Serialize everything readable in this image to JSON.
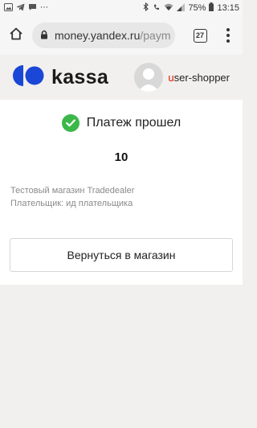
{
  "status_bar": {
    "battery": "75%",
    "time": "13:15",
    "notification_icons": [
      "image-icon",
      "telegram-icon",
      "chat-icon"
    ],
    "system_icons": [
      "bluetooth-icon",
      "wifi-icon",
      "signal-icon",
      "battery-icon"
    ]
  },
  "browser": {
    "url_host": "money.yandex.ru",
    "url_path": "/paym",
    "tab_count": "27"
  },
  "header": {
    "logo_text": "kassa",
    "user_first_letter": "u",
    "user_rest": "ser-shopper"
  },
  "payment": {
    "status": "Платеж прошел",
    "amount": "10",
    "shop": "Тестовый магазин Tradedealer",
    "payer": "Плательщик: ид плательщика",
    "return_button": "Вернуться в магазин"
  },
  "colors": {
    "accent_blue": "#1a47d6",
    "success_green": "#3cb84a",
    "brand_red": "#e61400"
  }
}
